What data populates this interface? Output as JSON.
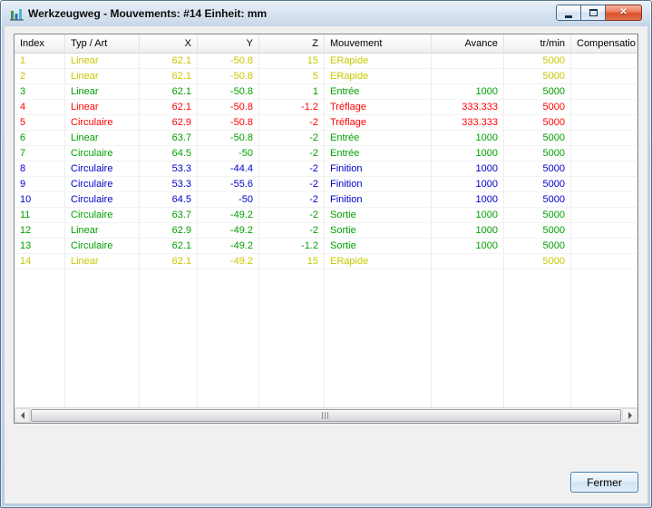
{
  "window": {
    "title": "Werkzeugweg  - Mouvements: #14 Einheit: mm",
    "close_glyph": "✕"
  },
  "table": {
    "columns": [
      {
        "label": "Index"
      },
      {
        "label": "Typ / Art"
      },
      {
        "label": "X"
      },
      {
        "label": "Y"
      },
      {
        "label": "Z"
      },
      {
        "label": "Mouvement"
      },
      {
        "label": "Avance"
      },
      {
        "label": "tr/min"
      },
      {
        "label": "Compensatio"
      }
    ],
    "category_colors": {
      "rapide": "#c8c800",
      "entree": "#00a000",
      "treflage": "#ff0000",
      "finition": "#0000cc",
      "sortie": "#00a000"
    },
    "rows": [
      {
        "index": "1",
        "type": "Linear",
        "x": "62.1",
        "y": "-50.8",
        "z": "15",
        "movement": "ERapide",
        "feed": "",
        "rpm": "5000",
        "comp": "",
        "category": "rapide"
      },
      {
        "index": "2",
        "type": "Linear",
        "x": "62.1",
        "y": "-50.8",
        "z": "5",
        "movement": "ERapide",
        "feed": "",
        "rpm": "5000",
        "comp": "",
        "category": "rapide"
      },
      {
        "index": "3",
        "type": "Linear",
        "x": "62.1",
        "y": "-50.8",
        "z": "1",
        "movement": "Entrée",
        "feed": "1000",
        "rpm": "5000",
        "comp": "",
        "category": "entree"
      },
      {
        "index": "4",
        "type": "Linear",
        "x": "62.1",
        "y": "-50.8",
        "z": "-1.2",
        "movement": "Tréflage",
        "feed": "333.333",
        "rpm": "5000",
        "comp": "",
        "category": "treflage"
      },
      {
        "index": "5",
        "type": "Circulaire",
        "x": "62.9",
        "y": "-50.8",
        "z": "-2",
        "movement": "Tréflage",
        "feed": "333.333",
        "rpm": "5000",
        "comp": "",
        "category": "treflage"
      },
      {
        "index": "6",
        "type": "Linear",
        "x": "63.7",
        "y": "-50.8",
        "z": "-2",
        "movement": "Entrée",
        "feed": "1000",
        "rpm": "5000",
        "comp": "",
        "category": "entree"
      },
      {
        "index": "7",
        "type": "Circulaire",
        "x": "64.5",
        "y": "-50",
        "z": "-2",
        "movement": "Entrée",
        "feed": "1000",
        "rpm": "5000",
        "comp": "",
        "category": "entree"
      },
      {
        "index": "8",
        "type": "Circulaire",
        "x": "53.3",
        "y": "-44.4",
        "z": "-2",
        "movement": "Finition",
        "feed": "1000",
        "rpm": "5000",
        "comp": "",
        "category": "finition"
      },
      {
        "index": "9",
        "type": "Circulaire",
        "x": "53.3",
        "y": "-55.6",
        "z": "-2",
        "movement": "Finition",
        "feed": "1000",
        "rpm": "5000",
        "comp": "",
        "category": "finition"
      },
      {
        "index": "10",
        "type": "Circulaire",
        "x": "64.5",
        "y": "-50",
        "z": "-2",
        "movement": "Finition",
        "feed": "1000",
        "rpm": "5000",
        "comp": "",
        "category": "finition"
      },
      {
        "index": "11",
        "type": "Circulaire",
        "x": "63.7",
        "y": "-49.2",
        "z": "-2",
        "movement": "Sortie",
        "feed": "1000",
        "rpm": "5000",
        "comp": "",
        "category": "sortie"
      },
      {
        "index": "12",
        "type": "Linear",
        "x": "62.9",
        "y": "-49.2",
        "z": "-2",
        "movement": "Sortie",
        "feed": "1000",
        "rpm": "5000",
        "comp": "",
        "category": "sortie"
      },
      {
        "index": "13",
        "type": "Circulaire",
        "x": "62.1",
        "y": "-49.2",
        "z": "-1.2",
        "movement": "Sortie",
        "feed": "1000",
        "rpm": "5000",
        "comp": "",
        "category": "sortie"
      },
      {
        "index": "14",
        "type": "Linear",
        "x": "62.1",
        "y": "-49.2",
        "z": "15",
        "movement": "ERapide",
        "feed": "",
        "rpm": "5000",
        "comp": "",
        "category": "rapide"
      }
    ]
  },
  "footer": {
    "close_label": "Fermer"
  }
}
